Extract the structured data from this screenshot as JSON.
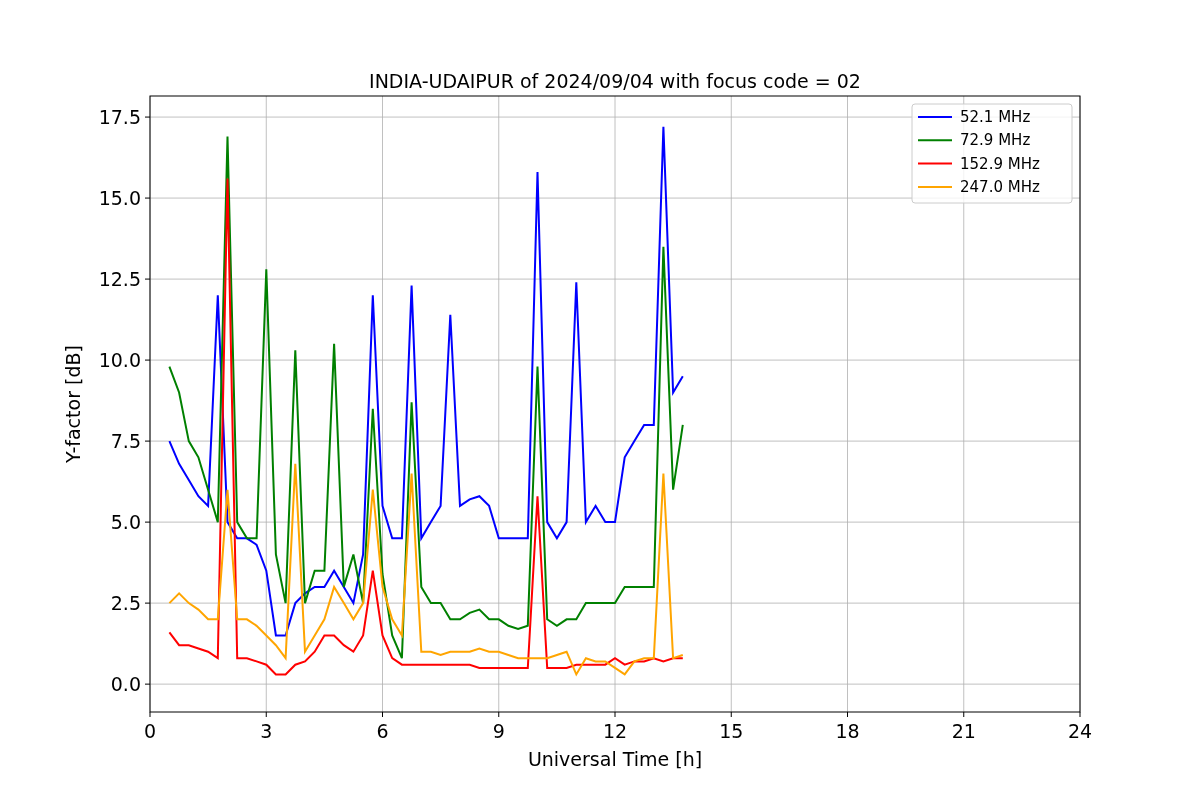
{
  "plot": {
    "chart_data": {
      "type": "line",
      "title": "INDIA-UDAIPUR of 2024/09/04 with focus code = 02",
      "xlabel": "Universal Time [h]",
      "ylabel": "Y-factor [dB]",
      "x": [
        0.5,
        0.75,
        1,
        1.25,
        1.5,
        1.75,
        2,
        2.25,
        2.5,
        2.75,
        3,
        3.25,
        3.5,
        3.75,
        4,
        4.25,
        4.5,
        4.75,
        5,
        5.25,
        5.5,
        5.75,
        6,
        6.25,
        6.5,
        6.75,
        7,
        7.25,
        7.5,
        7.75,
        8,
        8.25,
        8.5,
        8.75,
        9,
        9.25,
        9.5,
        9.75,
        10,
        10.25,
        10.5,
        10.75,
        11,
        11.25,
        11.5,
        11.75,
        12,
        12.25,
        12.5,
        12.75,
        13,
        13.25,
        13.5,
        13.75
      ],
      "series": [
        {
          "name": "52.1 MHz",
          "color": "#0000ff",
          "values": [
            7.5,
            6.8,
            6.3,
            5.8,
            5.5,
            12,
            5,
            4.5,
            4.5,
            4.3,
            3.5,
            1.5,
            1.5,
            2.5,
            2.8,
            3,
            3,
            3.5,
            3,
            2.5,
            4,
            12,
            5.5,
            4.5,
            4.5,
            12.3,
            4.5,
            5,
            5.5,
            11.4,
            5.5,
            5.7,
            5.8,
            5.5,
            4.5,
            4.5,
            4.5,
            4.5,
            15.8,
            5,
            4.5,
            5,
            12.4,
            5,
            5.5,
            5,
            5,
            7,
            7.5,
            8,
            8,
            17.2,
            9,
            9.5
          ]
        },
        {
          "name": "72.9 MHz",
          "color": "#008000",
          "values": [
            9.8,
            9,
            7.5,
            7,
            6,
            5,
            16.9,
            5,
            4.5,
            4.5,
            12.8,
            4,
            2.5,
            10.3,
            2.5,
            3.5,
            3.5,
            10.5,
            3,
            4,
            2.5,
            8.5,
            3.4,
            1.5,
            0.8,
            8.7,
            3,
            2.5,
            2.5,
            2,
            2,
            2.2,
            2.3,
            2,
            2,
            1.8,
            1.7,
            1.8,
            9.8,
            2,
            1.8,
            2,
            2,
            2.5,
            2.5,
            2.5,
            2.5,
            3,
            3,
            3,
            3,
            13.5,
            6,
            8
          ]
        },
        {
          "name": "152.9 MHz",
          "color": "#ff0000",
          "values": [
            1.6,
            1.2,
            1.2,
            1.1,
            1,
            0.8,
            15.6,
            0.8,
            0.8,
            0.7,
            0.6,
            0.3,
            0.3,
            0.6,
            0.7,
            1,
            1.5,
            1.5,
            1.2,
            1,
            1.5,
            3.5,
            1.5,
            0.8,
            0.6,
            0.6,
            0.6,
            0.6,
            0.6,
            0.6,
            0.6,
            0.6,
            0.5,
            0.5,
            0.5,
            0.5,
            0.5,
            0.5,
            5.8,
            0.5,
            0.5,
            0.5,
            0.6,
            0.6,
            0.6,
            0.6,
            0.8,
            0.6,
            0.7,
            0.7,
            0.8,
            0.7,
            0.8,
            0.8
          ]
        },
        {
          "name": "247.0 MHz",
          "color": "#ffa500",
          "values": [
            2.5,
            2.8,
            2.5,
            2.3,
            2,
            2,
            6,
            2,
            2,
            1.8,
            1.5,
            1.2,
            0.8,
            6.8,
            1,
            1.5,
            2,
            3,
            2.5,
            2,
            2.5,
            6,
            3,
            2,
            1.5,
            6.5,
            1,
            1,
            0.9,
            1,
            1,
            1,
            1.1,
            1,
            1,
            0.9,
            0.8,
            0.8,
            0.8,
            0.8,
            0.9,
            1,
            0.3,
            0.8,
            0.7,
            0.7,
            0.5,
            0.3,
            0.7,
            0.8,
            0.8,
            6.5,
            0.8,
            0.9
          ]
        }
      ],
      "grid": true,
      "legend": "upper right",
      "xlim": [
        0,
        24
      ],
      "ylim": [
        -0.86,
        18.15
      ],
      "xticks": [
        0,
        3,
        6,
        9,
        12,
        15,
        18,
        21,
        24
      ],
      "yticks": [
        {
          "value": 0,
          "label": "0.0"
        },
        {
          "value": 2.5,
          "label": "2.5"
        },
        {
          "value": 5,
          "label": "5.0"
        },
        {
          "value": 7.5,
          "label": "7.5"
        },
        {
          "value": 10,
          "label": "10.0"
        },
        {
          "value": 12.5,
          "label": "12.5"
        },
        {
          "value": 15,
          "label": "15.0"
        },
        {
          "value": 17.5,
          "label": "17.5"
        }
      ]
    }
  }
}
